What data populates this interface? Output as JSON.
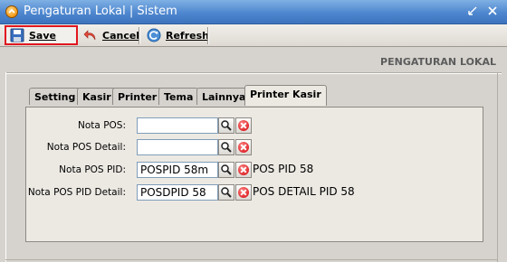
{
  "window": {
    "title": "Pengaturan Lokal | Sistem"
  },
  "toolbar": {
    "save_label": "Save",
    "cancel_label": "Cancel",
    "refresh_label": "Refresh"
  },
  "section_header": "PENGATURAN LOKAL",
  "tabs": [
    {
      "label": "Setting"
    },
    {
      "label": "Kasir"
    },
    {
      "label": "Printer"
    },
    {
      "label": "Tema"
    },
    {
      "label": "Lainnya"
    },
    {
      "label": "Printer Kasir",
      "active": true
    }
  ],
  "fields": [
    {
      "label": "Nota POS:",
      "value": "",
      "description": ""
    },
    {
      "label": "Nota POS Detail:",
      "value": "",
      "description": ""
    },
    {
      "label": "Nota POS PID:",
      "value": "POSPID  58m",
      "description": "POS PID 58"
    },
    {
      "label": "Nota POS PID Detail:",
      "value": "POSDPID  58",
      "description": "POS DETAIL PID 58"
    }
  ],
  "colors": {
    "titlebar": "#4e87cf",
    "highlight": "#e0161f"
  }
}
